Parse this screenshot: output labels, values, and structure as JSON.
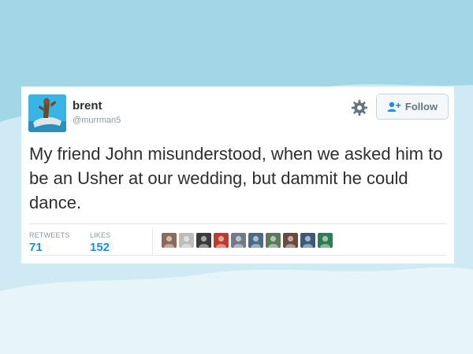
{
  "tweet": {
    "display_name": "brent",
    "handle": "@murrman5",
    "text": "My friend John misunderstood, when we asked him to be an Usher at our wedding, but dammit he could dance.",
    "follow_label": "Follow",
    "stats": {
      "retweets_label": "RETWEETS",
      "retweets_value": "71",
      "likes_label": "LIKES",
      "likes_value": "152"
    },
    "liker_avatar_colors": [
      "#8b6a5a",
      "#bdbdbd",
      "#3b3b3b",
      "#c0392b",
      "#6f7a8a",
      "#4a6a8a",
      "#5a7a5a",
      "#6b4a3a",
      "#3b5a7a",
      "#2e7d4f"
    ]
  },
  "colors": {
    "background": "#9fd7e4",
    "link_blue": "#1e8fe0",
    "text": "#292f33",
    "muted": "#8899a6"
  },
  "icons": {
    "settings": "gear-icon",
    "follow": "add-user-icon"
  }
}
